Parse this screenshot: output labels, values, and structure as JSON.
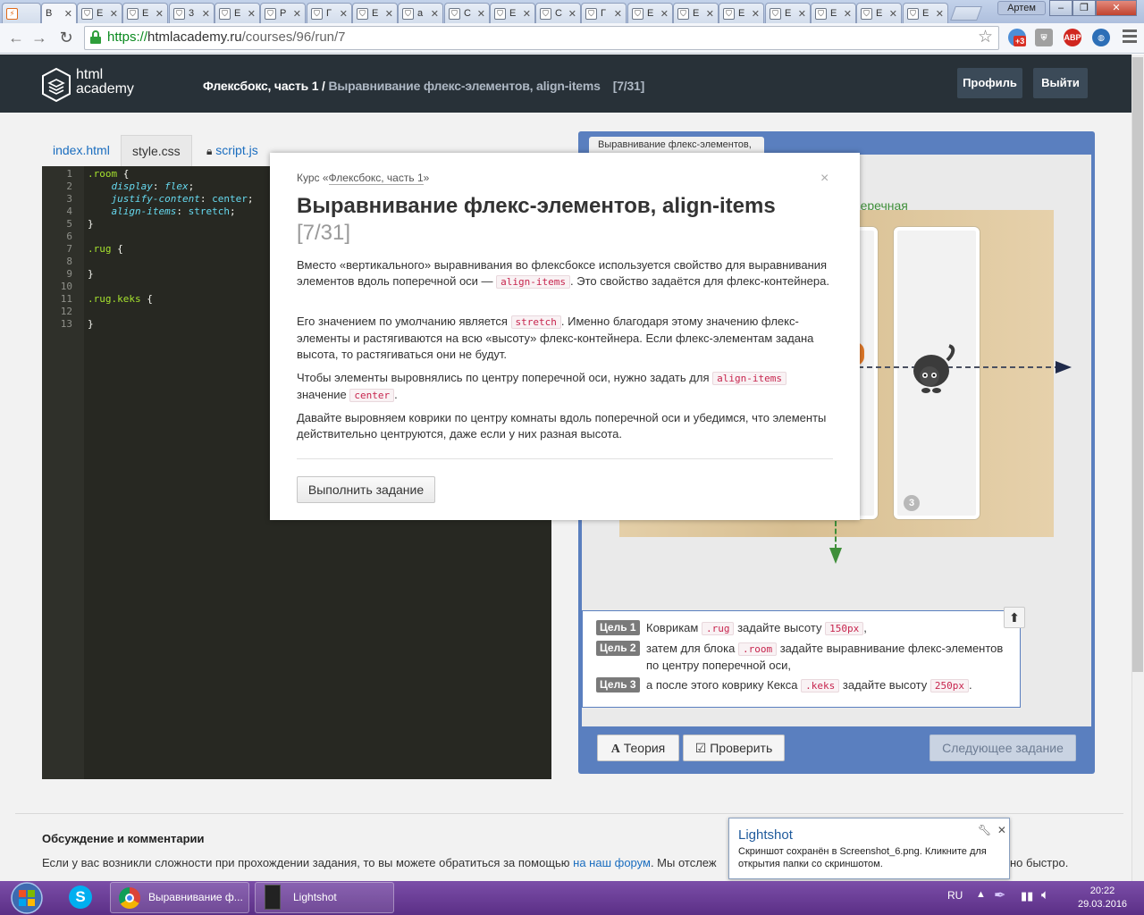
{
  "browser": {
    "tabs_first_letter": "В",
    "tab_letters": [
      "Е",
      "Е",
      "3",
      "E",
      "Р",
      "Г",
      "Е",
      "а",
      "С",
      "E",
      "С",
      "Г",
      "Е",
      "Е",
      "Е",
      "Е",
      "Е",
      "Е",
      "Е"
    ],
    "active_tab": "В",
    "user_chip": "Артем",
    "url": {
      "scheme": "https://",
      "host": "htmlacademy.ru",
      "path": "/courses/96/run/7"
    },
    "ext_badge": "+3",
    "abp_label": "ABP"
  },
  "site": {
    "logo_line1": "html",
    "logo_line2": "academy",
    "crumb_course": "Флексбокс, часть 1",
    "crumb_sep": " / ",
    "crumb_lesson": "Выравнивание флекс-элементов, align-items",
    "crumb_counter": "[7/31]",
    "profile_btn": "Профиль",
    "logout_btn": "Выйти"
  },
  "editor": {
    "tabs": [
      "index.html",
      "style.css",
      "script.js"
    ],
    "active_tab": "style.css",
    "line_numbers": [
      "1",
      "2",
      "3",
      "4",
      "5",
      "6",
      "7",
      "8",
      "9",
      "10",
      "11",
      "12",
      "13"
    ],
    "lines": {
      "l1_sel": ".room",
      "l1_brace": " {",
      "l2_prop": "display",
      "l2_val": "flex",
      "l3_prop": "justify-content",
      "l3_val": "center",
      "l4_prop": "align-items",
      "l4_val": "stretch",
      "l5": "}",
      "l7_sel": ".rug",
      "l7_brace": " {",
      "l9": "}",
      "l11_sel": ".rug.keks",
      "l11_brace": " {",
      "l13": "}"
    }
  },
  "preview": {
    "tab_label": "Выравнивание флекс-элементов,",
    "axis_label": "перечная",
    "rug_number": "3"
  },
  "goals": [
    {
      "badge": "Цель 1",
      "pre": "Коврикам",
      "code1": ".rug",
      "mid": "задайте высоту",
      "code2": "150px",
      "post": ","
    },
    {
      "badge": "Цель 2",
      "pre": "затем для блока",
      "code1": ".room",
      "mid": "задайте выравнивание флекс-элементов",
      "line2": "по центру поперечной оси,"
    },
    {
      "badge": "Цель 3",
      "pre": "а после этого коврику Кекса",
      "code1": ".keks",
      "mid": "задайте высоту",
      "code2": "250px",
      "post": "."
    }
  ],
  "buttons": {
    "theory": "Теория",
    "check": "Проверить",
    "next": "Следующее задание"
  },
  "discussion": {
    "title": "Обсуждение и комментарии",
    "text_pre": "Если у вас возникли сложности при прохождении задания, то вы можете обратиться за помощью ",
    "link": "на наш форум",
    "text_post": ". Мы отслеж",
    "text_tail": "но быстро."
  },
  "modal": {
    "course_prefix": "Курс «",
    "course_name": "Флексбокс, часть 1",
    "course_suffix": "»",
    "close": "×",
    "title": "Выравнивание флекс-элементов, align-items",
    "counter": "[7/31]",
    "p1_a": "Вместо «вертикального» выравнивания во флексбоксе используется свойство для выравнивания элементов вдоль поперечной оси — ",
    "p1_code": "align-items",
    "p1_b": ". Это свойство задаётся для флекс-контейнера.",
    "p2_a": "Его значением по умолчанию является ",
    "p2_code": "stretch",
    "p2_b": ". Именно благодаря этому значению флекс-элементы и растягиваются на всю «высоту» флекс-контейнера. Если флекс-элементам задана высота, то растягиваться они не будут.",
    "p3_a": "Чтобы элементы выровнялись по центру поперечной оси, нужно задать для ",
    "p3_code1": "align-items",
    "p3_b": " значение ",
    "p3_code2": "center",
    "p3_c": ".",
    "p4": "Давайте выровняем коврики по центру комнаты вдоль поперечной оси и убедимся, что элементы действительно центруются, даже если у них разная высота.",
    "action_btn": "Выполнить задание"
  },
  "notification": {
    "title": "Lightshot",
    "text": "Скриншот сохранён в Screenshot_6.png. Кликните для открытия папки со скриншотом."
  },
  "taskbar": {
    "chrome_item": "Выравнивание ф...",
    "lightshot_item": "Lightshot",
    "lang": "RU",
    "time": "20:22",
    "date": "29.03.2016"
  },
  "colors": {
    "header_bg": "#283138",
    "editor_bg": "#272822",
    "preview_frame": "#5a7fbf",
    "taskbar": "#6a3f97",
    "link": "#1a6dbf"
  }
}
